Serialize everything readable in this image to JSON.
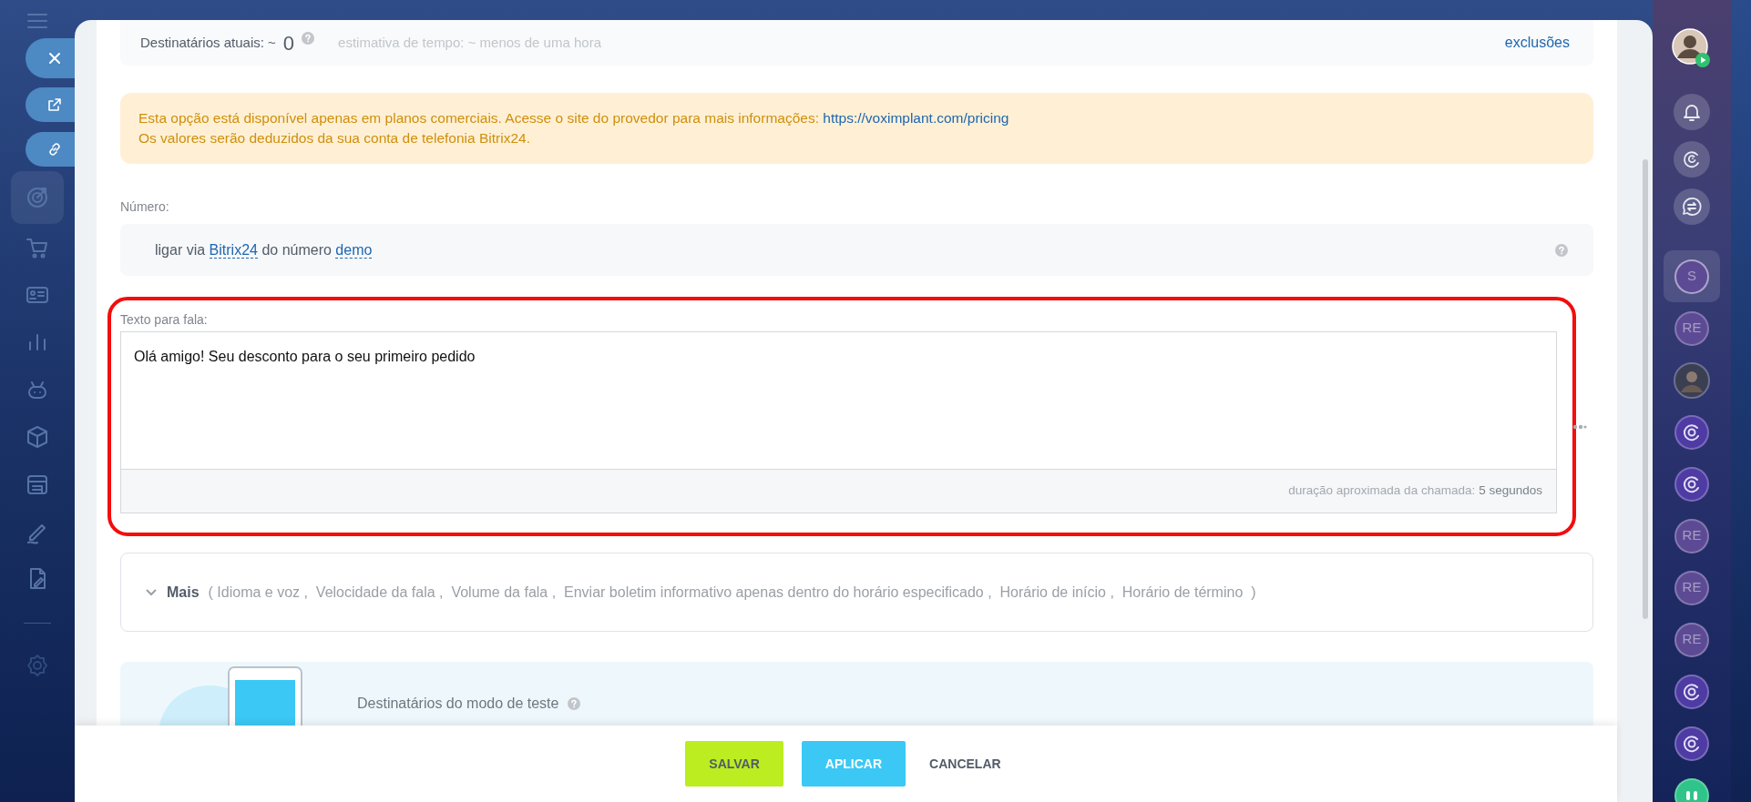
{
  "summary": {
    "recipients_label": "Destinatários atuais: ~",
    "recipients_count": "0",
    "time_estimate": "estimativa de tempo: ~ menos de uma hora",
    "exclusions_link": "exclusões"
  },
  "notice": {
    "text": "Esta opção está disponível apenas em planos comerciais. Acesse o site do provedor para mais informações:",
    "link": "https://voximplant.com/pricing",
    "text_2": "Os valores serão deduzidos da sua conta de telefonia Bitrix24."
  },
  "number": {
    "label": "Número:",
    "prefix": "ligar via",
    "provider": "Bitrix24",
    "middle": "do número",
    "number": "demo"
  },
  "speech_text": {
    "label": "Texto para fala:",
    "value": "Olá amigo! Seu desconto para o seu primeiro pedido",
    "duration_label": "duração aproximada da chamada:",
    "duration": "5 segundos",
    "highlighted": true
  },
  "more": {
    "label": "Mais",
    "expanded": false,
    "options": "( Idioma e voz ,  Velocidade da fala ,  Volume da fala ,  Enviar boletim informativo apenas dentro do horário especificado ,  Horário de início ,  Horário de término  )"
  },
  "test_mode": {
    "title": "Destinatários do modo de teste"
  },
  "buttons": [
    {
      "label": "SALVAR",
      "kind": "save"
    },
    {
      "label": "APLICAR",
      "kind": "apply"
    },
    {
      "label": "CANCELAR",
      "kind": "cancel"
    }
  ],
  "chats": [
    {
      "kind": "letters",
      "initials": "S",
      "selected": true
    },
    {
      "kind": "letters",
      "initials": "RE",
      "selected": false
    },
    {
      "kind": "photo",
      "selected": false
    },
    {
      "kind": "channel",
      "selected": false
    },
    {
      "kind": "channel",
      "selected": false
    },
    {
      "kind": "letters",
      "initials": "RE",
      "selected": false
    },
    {
      "kind": "letters",
      "initials": "RE",
      "selected": false
    },
    {
      "kind": "letters",
      "initials": "RE",
      "selected": false
    },
    {
      "kind": "channel",
      "selected": false
    },
    {
      "kind": "channel",
      "selected": false
    },
    {
      "kind": "group",
      "selected": false
    }
  ]
}
